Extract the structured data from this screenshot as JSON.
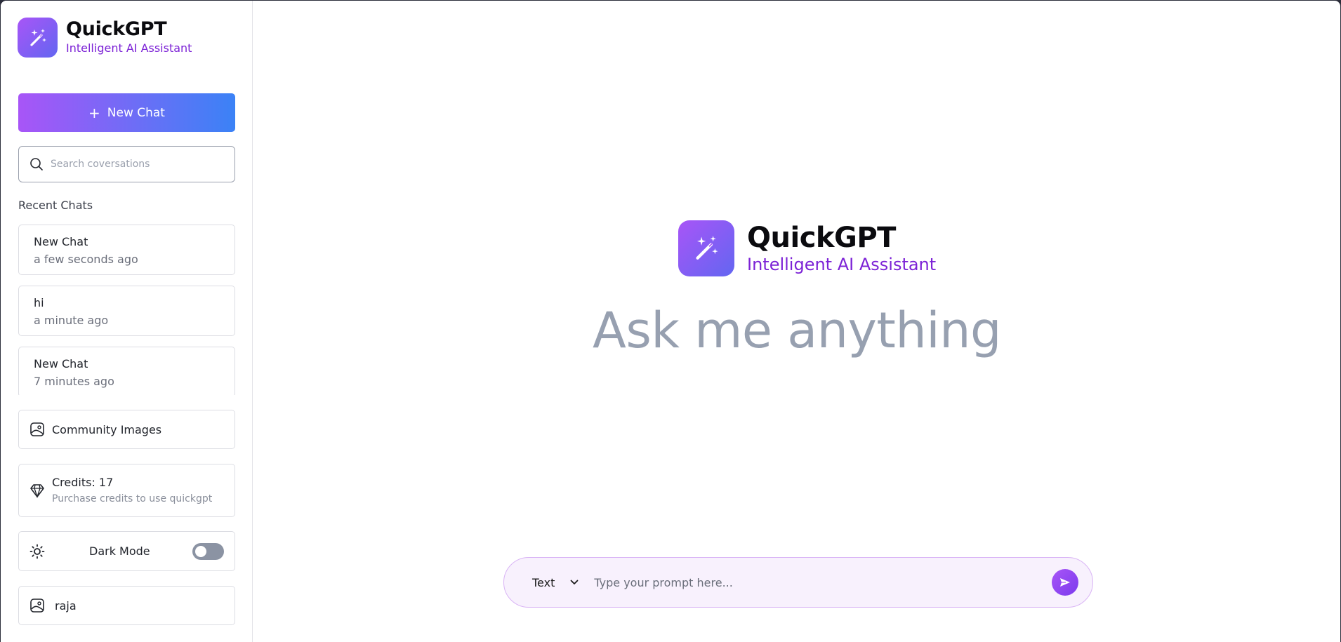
{
  "app": {
    "title": "QuickGPT",
    "subtitle": "Intelligent AI Assistant"
  },
  "sidebar": {
    "new_chat_label": "New Chat",
    "search_placeholder": "Search coversations",
    "recent_label": "Recent Chats",
    "chats": [
      {
        "title": "New Chat",
        "time": "a few seconds ago"
      },
      {
        "title": "hi",
        "time": "a minute ago"
      },
      {
        "title": "New Chat",
        "time": "7 minutes ago"
      }
    ],
    "community_label": "Community Images",
    "credits_label": "Credits: 17",
    "credits_hint": "Purchase credits to use quickgpt",
    "dark_mode_label": "Dark Mode",
    "dark_mode_on": false,
    "user_name": "raja"
  },
  "main": {
    "headline": "Ask me anything",
    "mode_value": "Text",
    "prompt_placeholder": "Type your prompt here..."
  },
  "colors": {
    "accent_purple": "#a855f7",
    "accent_blue": "#3b82f6",
    "subtitle_purple": "#7c22d6"
  }
}
